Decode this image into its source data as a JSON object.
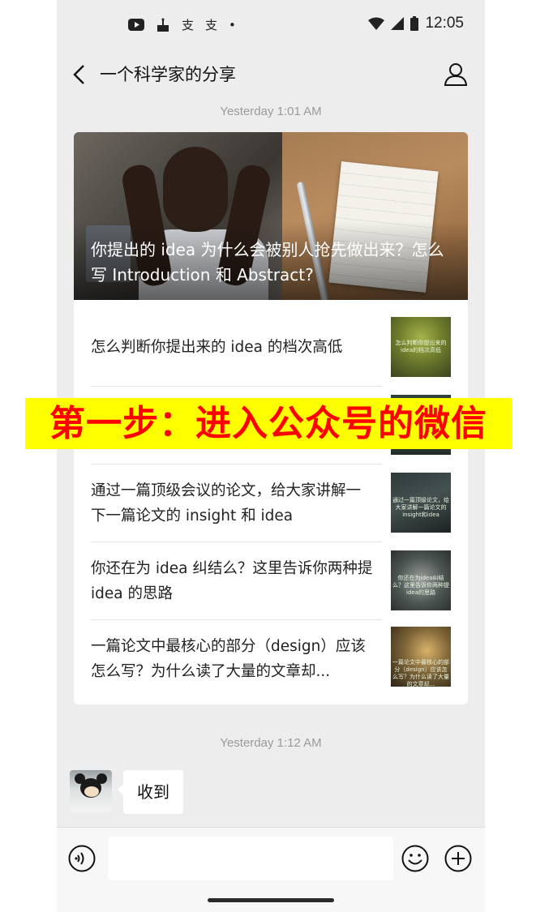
{
  "status_bar": {
    "time": "12:05",
    "left_icons": [
      "youtube-icon",
      "cake-icon",
      "app-icon",
      "app-icon",
      "dot-icon"
    ],
    "right_icons": [
      "wifi-icon",
      "signal-icon",
      "battery-icon"
    ]
  },
  "header": {
    "title": "一个科学家的分享"
  },
  "messages": {
    "timestamp_1": "Yesterday 1:01 AM",
    "timestamp_2": "Yesterday 1:12 AM",
    "reply_text": "收到"
  },
  "article_card": {
    "hero_title": "你提出的 idea 为什么会被别人抢先做出来？怎么写 Introduction 和 Abstract?",
    "items": [
      {
        "title": "怎么判断你提出来的 idea 的档次高低",
        "thumb_caption": "怎么判断你提出来的idea的档次高低"
      },
      {
        "title": "",
        "thumb_caption": ""
      },
      {
        "title": "通过一篇顶级会议的论文，给大家讲解一下一篇论文的 insight 和 idea",
        "thumb_caption": "通过一篇顶级论文，给大家讲解一篇论文的insight和idea"
      },
      {
        "title": "你还在为 idea 纠结么？这里告诉你两种提 idea 的思路",
        "thumb_caption": "你还在为idea纠结么？这里告诉你两种提idea的思路"
      },
      {
        "title": "一篇论文中最核心的部分（design）应该怎么写？为什么读了大量的文章却...",
        "thumb_caption": "一篇论文中最核心的部分（design）应该怎么写？为什么读了大量的文章却..."
      }
    ]
  },
  "overlay": {
    "banner_text": "第一步：进入公众号的微信",
    "banner_bg": "#ffff00",
    "banner_color": "#ff0000"
  },
  "input_bar": {
    "placeholder": ""
  }
}
